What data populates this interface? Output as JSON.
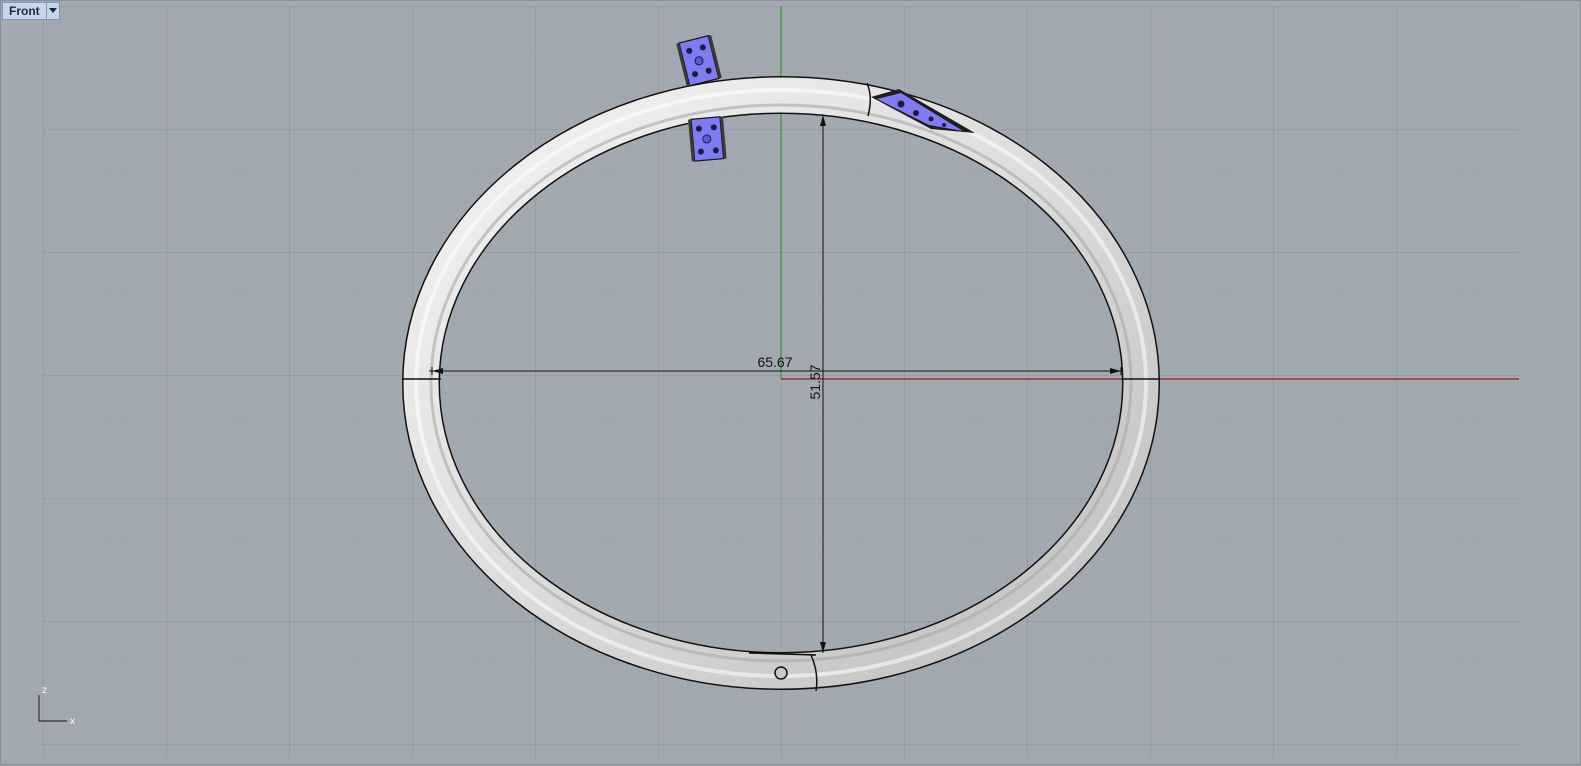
{
  "viewport": {
    "name": "Front",
    "menu_icon": "dropdown-arrow-icon"
  },
  "dimensions": {
    "width_value": "65.67",
    "height_value": "51.57"
  },
  "axes_widget": {
    "vertical_label": "z",
    "horizontal_label": "x"
  },
  "colors": {
    "grid_minor": "#98a0a9",
    "grid_major": "#8a929c",
    "x_axis": "#9a1b1b",
    "z_axis": "#2aa02a",
    "ring_fill": "#e2e2e2",
    "ring_edge": "#111111",
    "gem_fill": "#7f7cf2"
  }
}
